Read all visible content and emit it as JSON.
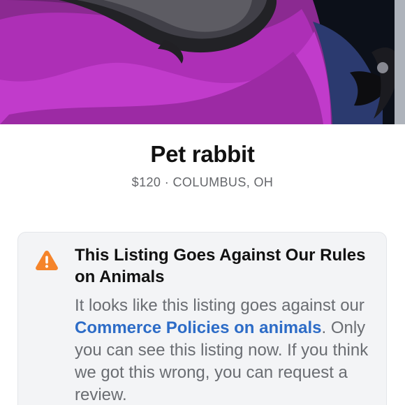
{
  "listing": {
    "title": "Pet rabbit",
    "price": "$120",
    "separator": " · ",
    "location": "COLUMBUS, OH"
  },
  "notice": {
    "icon": "warning-triangle-icon",
    "icon_color": "#f5842a",
    "title": "This Listing Goes Against Our Rules on Animals",
    "body_before": "It looks like this listing goes against our ",
    "link_text": "Commerce Policies on animals",
    "body_after": ". Only you can see this listing now. If you think we got this wrong, you can request a review.",
    "link_color": "#2d6cc7"
  },
  "colors": {
    "background": "#ffffff",
    "notice_background": "#f3f4f6",
    "text_primary": "#111111",
    "text_secondary": "#65676b"
  }
}
